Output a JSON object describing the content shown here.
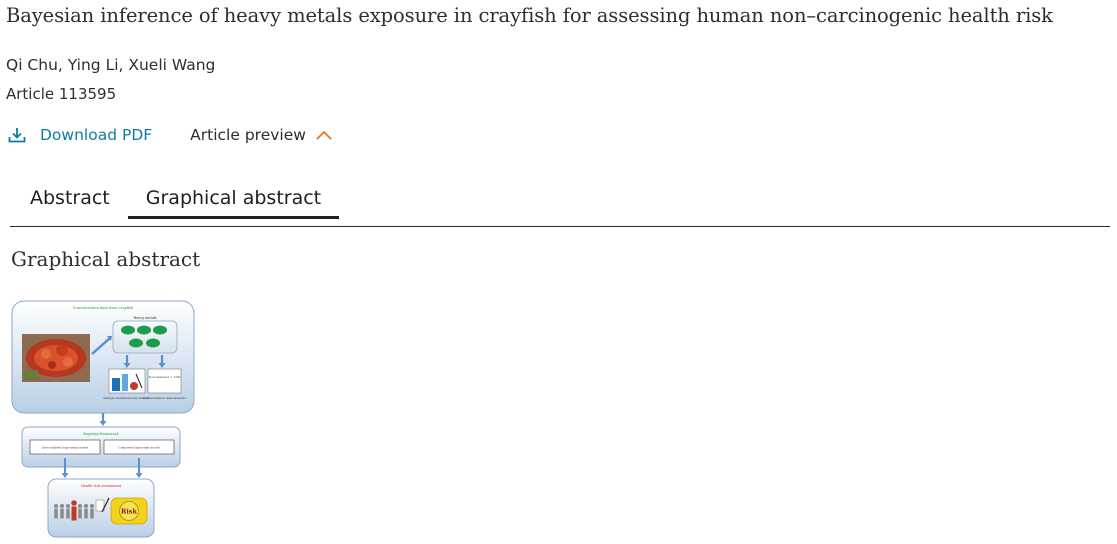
{
  "article": {
    "title": "Bayesian inference of heavy metals exposure in crayfish for assessing human non–carcinogenic health risk",
    "authors": "Qi Chu, Ying Li, Xueli Wang",
    "article_id": "Article 113595"
  },
  "actions": {
    "download_icon": "download-icon",
    "download_label": "Download PDF",
    "preview_label": "Article preview",
    "preview_icon": "chevron-up-icon"
  },
  "tabs": [
    {
      "label": "Abstract",
      "active": false
    },
    {
      "label": "Graphical abstract",
      "active": true
    }
  ],
  "section": {
    "heading": "Graphical abstract"
  },
  "graphical_abstract": {
    "top_title": "Concentration data from crayfish",
    "heavy_metals_label": "Heavy metals",
    "box_left_label": "Sample treatment and analysis",
    "box_right_inner": "Non-detected < LOD",
    "box_right_label": "Concentration data analysis",
    "middle_title": "Bayesian framework",
    "model_left": "Zero-inflated lognormal model",
    "model_right": "Censored lognormal model",
    "bottom_title": "Health risk assessment",
    "risk_label": "Risk"
  },
  "colors": {
    "link": "#0c7d9d",
    "accent_orange": "#e9711c",
    "text": "#2e2e2e"
  }
}
